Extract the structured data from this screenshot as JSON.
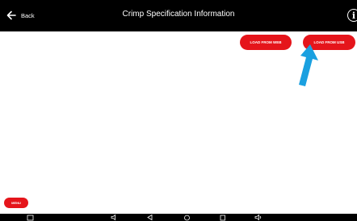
{
  "header": {
    "back_label": "Back",
    "title": "Crimp Specification Information",
    "back_icon": "left-arrow-icon",
    "info_icon": "info-icon",
    "info_glyph": "i"
  },
  "actions": {
    "load_from_web": "LOAD FROM WEB",
    "load_from_usb": "LOAD FROM USB"
  },
  "menu_label": "MENU",
  "annotation_icon": "blue-arrow-pointer-icon",
  "navbar_icons": [
    "screenshot-icon",
    "volume-down-icon",
    "back-triangle-icon",
    "home-circle-icon",
    "recent-apps-icon",
    "volume-up-icon"
  ],
  "colors": {
    "accent_red": "#e5151b",
    "header_bg": "#000000",
    "pointer_blue": "#1aa0e0"
  }
}
